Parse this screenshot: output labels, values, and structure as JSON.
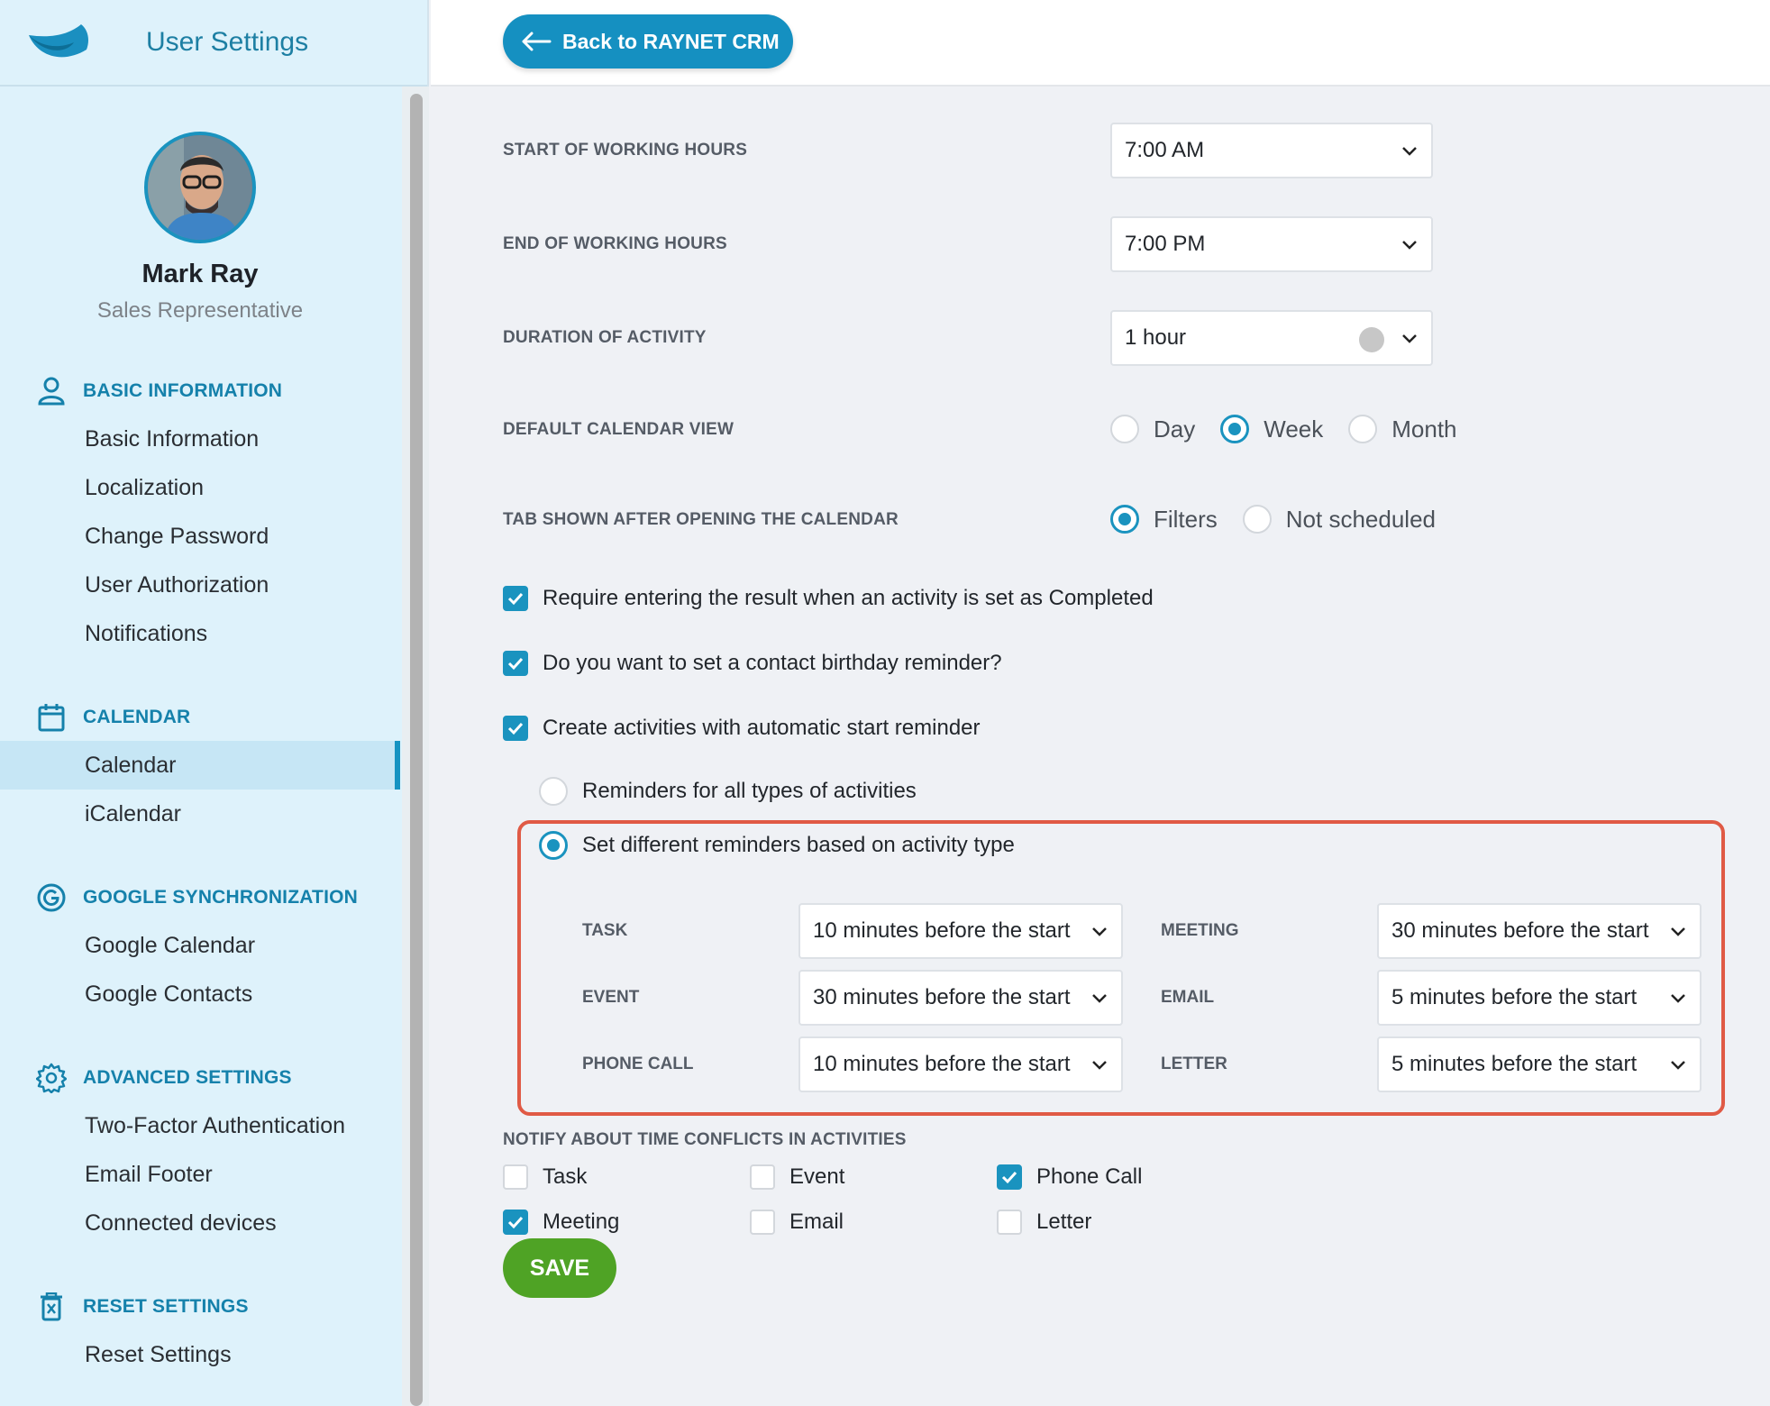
{
  "app": {
    "title": "User Settings",
    "back_label": "Back to RAYNET CRM"
  },
  "profile": {
    "name": "Mark Ray",
    "role": "Sales Representative"
  },
  "sidebar": {
    "sections": [
      {
        "title": "BASIC INFORMATION",
        "icon": "user-icon",
        "items": [
          "Basic Information",
          "Localization",
          "Change Password",
          "User Authorization",
          "Notifications"
        ]
      },
      {
        "title": "CALENDAR",
        "icon": "calendar-icon",
        "items": [
          "Calendar",
          "iCalendar"
        ],
        "active": "Calendar"
      },
      {
        "title": "GOOGLE SYNCHRONIZATION",
        "icon": "google-icon",
        "items": [
          "Google Calendar",
          "Google Contacts"
        ]
      },
      {
        "title": "ADVANCED SETTINGS",
        "icon": "gear-icon",
        "items": [
          "Two-Factor Authentication",
          "Email Footer",
          "Connected devices"
        ]
      },
      {
        "title": "RESET SETTINGS",
        "icon": "trash-icon",
        "items": [
          "Reset Settings"
        ]
      }
    ]
  },
  "form": {
    "start_hours": {
      "label": "START OF WORKING HOURS",
      "value": "7:00 AM"
    },
    "end_hours": {
      "label": "END OF WORKING HOURS",
      "value": "7:00 PM"
    },
    "duration": {
      "label": "DURATION OF ACTIVITY",
      "value": "1 hour"
    },
    "calendar_view": {
      "label": "DEFAULT CALENDAR VIEW",
      "options": [
        "Day",
        "Week",
        "Month"
      ],
      "selected": "Week"
    },
    "tab_shown": {
      "label": "TAB SHOWN AFTER OPENING THE CALENDAR",
      "options": [
        "Filters",
        "Not scheduled"
      ],
      "selected": "Filters"
    },
    "checks": [
      {
        "label": "Require entering the result when an activity is set as Completed",
        "checked": true
      },
      {
        "label": "Do you want to set a contact birthday reminder?",
        "checked": true
      },
      {
        "label": "Create activities with automatic start reminder",
        "checked": true
      }
    ],
    "reminder_mode": {
      "options": [
        "Reminders for all types of activities",
        "Set different reminders based on activity type"
      ],
      "selected": "Set different reminders based on activity type"
    },
    "reminders": {
      "task": {
        "label": "TASK",
        "value": "10 minutes before the start"
      },
      "meeting": {
        "label": "MEETING",
        "value": "30 minutes before the start"
      },
      "event": {
        "label": "EVENT",
        "value": "30 minutes before the start"
      },
      "email": {
        "label": "EMAIL",
        "value": "5 minutes before the start"
      },
      "phone_call": {
        "label": "PHONE CALL",
        "value": "10 minutes before the start"
      },
      "letter": {
        "label": "LETTER",
        "value": "5 minutes before the start"
      }
    },
    "conflicts": {
      "label": "NOTIFY ABOUT TIME CONFLICTS IN ACTIVITIES",
      "items": [
        {
          "label": "Task",
          "checked": false
        },
        {
          "label": "Event",
          "checked": false
        },
        {
          "label": "Phone Call",
          "checked": true
        },
        {
          "label": "Meeting",
          "checked": true
        },
        {
          "label": "Email",
          "checked": false
        },
        {
          "label": "Letter",
          "checked": false
        }
      ]
    },
    "save_label": "SAVE"
  },
  "colors": {
    "accent": "#1a93bf",
    "save": "#4fa325",
    "highlight": "#e05a45",
    "sidebar_bg": "#def2fb"
  }
}
